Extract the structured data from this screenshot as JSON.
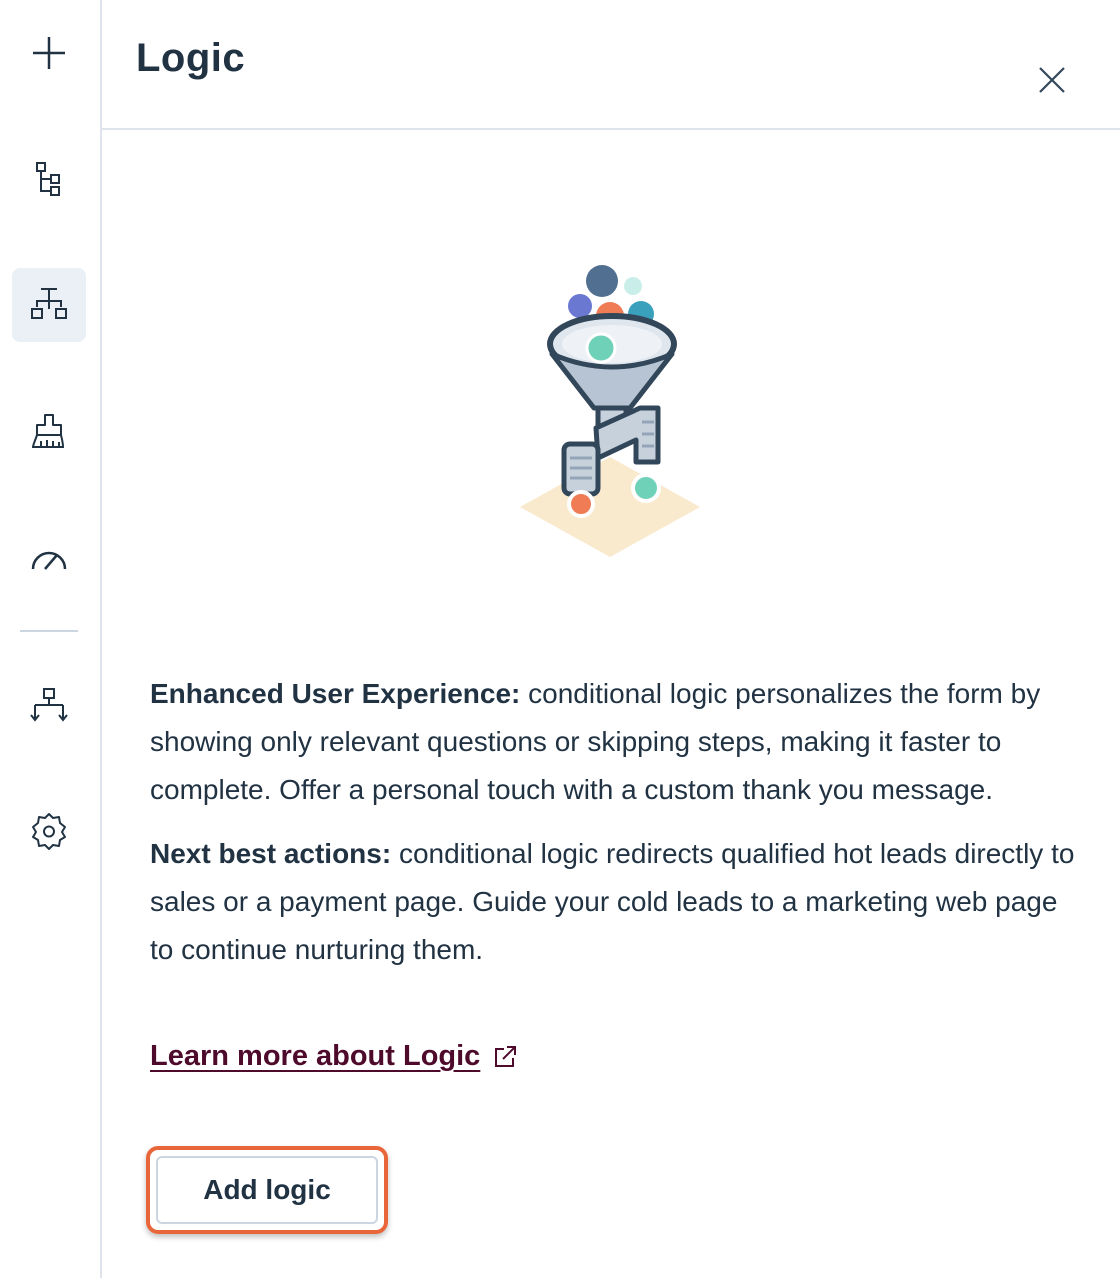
{
  "sidebar": {
    "items": [
      {
        "icon": "plus-icon",
        "active": false
      },
      {
        "icon": "tree-structure-icon",
        "active": false
      },
      {
        "icon": "logic-branch-icon",
        "active": true
      },
      {
        "icon": "paint-brush-icon",
        "active": false
      },
      {
        "icon": "speedometer-icon",
        "active": false
      },
      {
        "icon": "workflow-icon",
        "active": false
      },
      {
        "icon": "gear-icon",
        "active": false
      }
    ]
  },
  "panel": {
    "title": "Logic",
    "close_icon": "close-icon"
  },
  "content": {
    "para1_bold": "Enhanced User Experience:",
    "para1_text": " conditional logic personalizes the form by showing only relevant questions or skipping steps, making it faster to complete. Offer a personal touch with a custom thank you message.",
    "para2_bold": "Next best actions:",
    "para2_text": " conditional logic redirects qualified hot leads directly to sales or a payment page. Guide your cold leads to a marketing web page to continue nurturing them.",
    "learn_more_label": "Learn more about Logic",
    "learn_more_icon": "external-link-icon",
    "add_logic_label": "Add logic"
  },
  "colors": {
    "accent_highlight": "#e8663a",
    "link": "#4d0a2b",
    "active_bg": "#eaf0f6"
  }
}
